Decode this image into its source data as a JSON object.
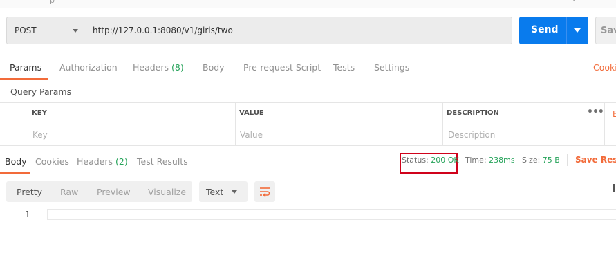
{
  "top_strip": {
    "crumb": "p"
  },
  "request": {
    "method": "POST",
    "url": "http://127.0.0.1:8080/v1/girls/two",
    "send_label": "Send",
    "save_label": "Sav"
  },
  "request_tabs": {
    "params": "Params",
    "authorization": "Authorization",
    "headers": "Headers",
    "headers_count": "(8)",
    "body": "Body",
    "prerequest": "Pre-request Script",
    "tests": "Tests",
    "settings": "Settings",
    "cookies": "Cookie"
  },
  "query_params": {
    "title": "Query Params",
    "columns": {
      "key": "KEY",
      "value": "VALUE",
      "description": "DESCRIPTION"
    },
    "more": "•••",
    "bulk_edit": "B",
    "row_placeholders": {
      "key": "Key",
      "value": "Value",
      "description": "Description"
    }
  },
  "response": {
    "tabs": {
      "body": "Body",
      "cookies": "Cookies",
      "headers": "Headers",
      "headers_count": "(2)",
      "test_results": "Test Results"
    },
    "status_label": "Status:",
    "status_value": "200 OK",
    "time_label": "Time:",
    "time_value": "238ms",
    "size_label": "Size:",
    "size_value": "75 B",
    "save_response": "Save Resp"
  },
  "view": {
    "modes": [
      "Pretty",
      "Raw",
      "Preview",
      "Visualize"
    ],
    "active_mode": "Pretty",
    "format": "Text"
  },
  "editor": {
    "line_numbers": [
      "1"
    ]
  },
  "colors": {
    "accent": "#f26b3a",
    "send": "#097bed",
    "success": "#26a35a",
    "highlight_box": "#d0021b"
  }
}
